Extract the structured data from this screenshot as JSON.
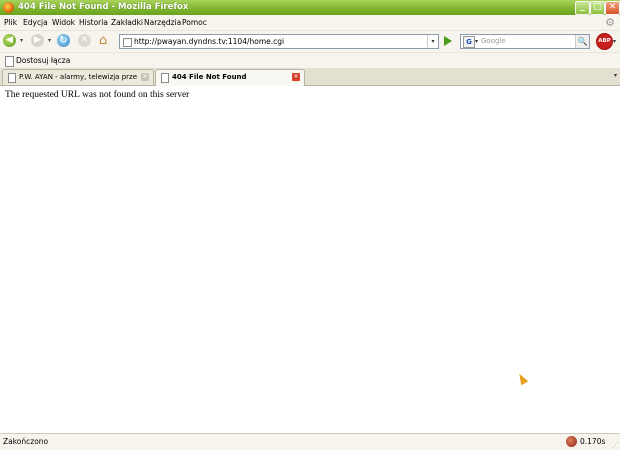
{
  "window": {
    "title": "404 File Not Found - Mozilla Firefox",
    "minimize": "_",
    "maximize": "□",
    "close": "✕"
  },
  "menu": {
    "items": [
      "Plik",
      "Edycja",
      "Widok",
      "Historia",
      "Zakładki",
      "Narzędzia",
      "Pomoc"
    ]
  },
  "nav": {
    "url": "http://pwayan.dyndns.tv:1104/home.cgi",
    "search_placeholder": "Google",
    "back_icon": "◀",
    "forward_icon": "▶",
    "reload_icon": "↻",
    "stop_icon": "✕",
    "home_icon": "⌂",
    "dropdown_icon": "▾",
    "search_engine_icon": "G",
    "search_icon": "🔍",
    "abp_label": "ABP"
  },
  "bookmarks": {
    "label": "Dostosuj łącza"
  },
  "tabs": [
    {
      "label": "P.W. AYAN - alarmy, telewizja przemy...",
      "active": false,
      "close": "✕"
    },
    {
      "label": "404 File Not Found",
      "active": true,
      "close": "✕"
    }
  ],
  "content": {
    "message": "The requested URL was not found on this server"
  },
  "status": {
    "text": "Zakończono",
    "timing": "0.170s"
  }
}
